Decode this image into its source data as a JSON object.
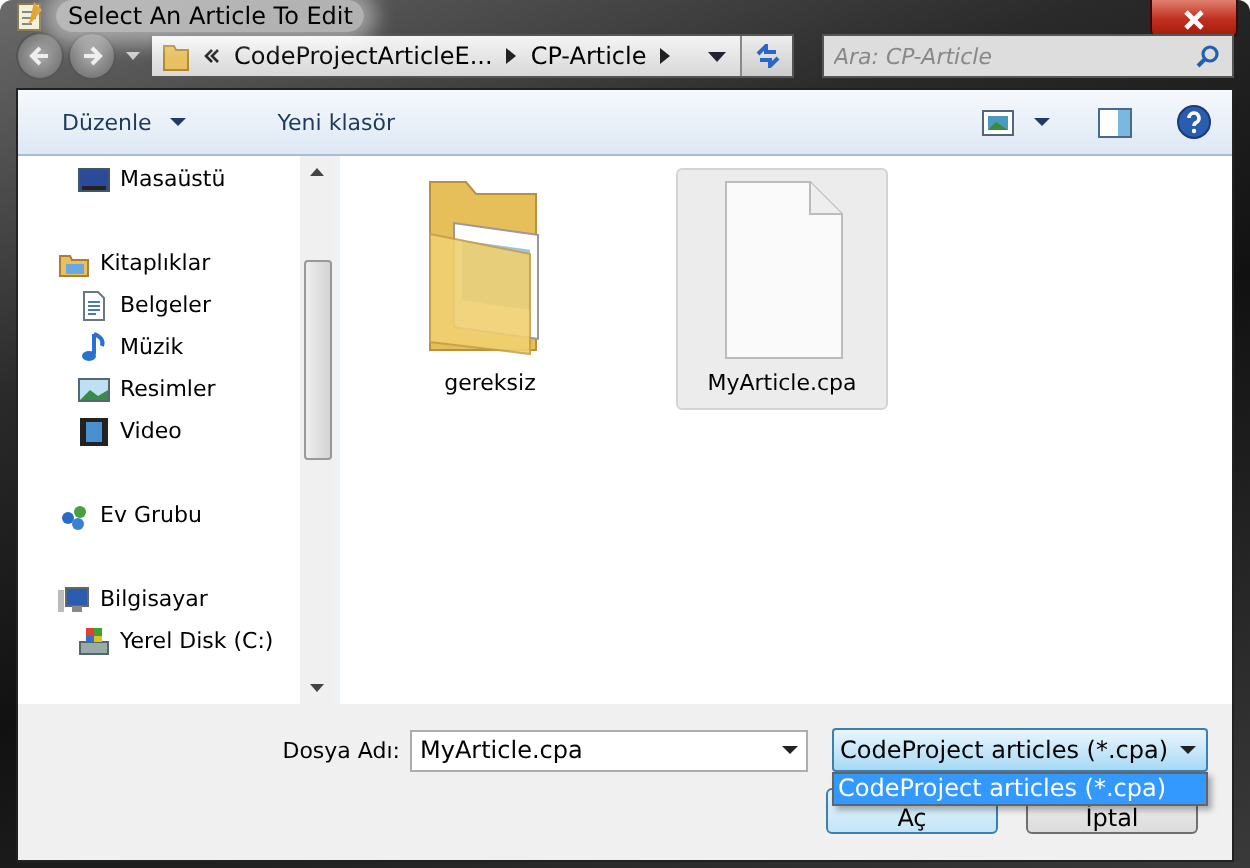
{
  "window": {
    "title": "Select An Article To Edit"
  },
  "address": {
    "parts": [
      "CodeProjectArticleE...",
      "CP-Article"
    ]
  },
  "search": {
    "placeholder": "Ara: CP-Article"
  },
  "toolbar": {
    "buttons": [
      {
        "label": "Düzenle",
        "dropdown": true
      },
      {
        "label": "Yeni klasör",
        "dropdown": false
      }
    ]
  },
  "sidebar": {
    "groups": [
      {
        "children": [
          {
            "label": "Masaüstü",
            "kind": "desktop"
          }
        ]
      },
      {
        "heading": {
          "label": "Kitaplıklar",
          "kind": "library"
        },
        "children": [
          {
            "label": "Belgeler",
            "kind": "documents"
          },
          {
            "label": "Müzik",
            "kind": "music"
          },
          {
            "label": "Resimler",
            "kind": "pictures"
          },
          {
            "label": "Video",
            "kind": "video"
          }
        ]
      },
      {
        "heading": {
          "label": "Ev Grubu",
          "kind": "homegroup"
        }
      },
      {
        "heading": {
          "label": "Bilgisayar",
          "kind": "computer"
        },
        "children": [
          {
            "label": "Yerel Disk (C:)",
            "kind": "disk"
          }
        ]
      }
    ]
  },
  "files": [
    {
      "name": "gereksiz",
      "kind": "folder",
      "selected": false
    },
    {
      "name": "MyArticle.cpa",
      "kind": "document",
      "selected": true
    }
  ],
  "footer": {
    "filename_label": "Dosya Adı:",
    "filename": "MyArticle.cpa",
    "filter": "CodeProject articles (*.cpa)",
    "filter_options": [
      {
        "label": "CodeProject articles (*.cpa)",
        "selected": true
      }
    ],
    "buttons": [
      "Aç",
      "İptal"
    ]
  }
}
